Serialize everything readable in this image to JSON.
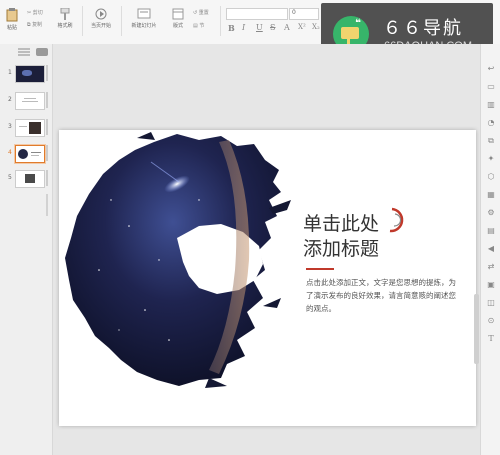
{
  "ribbon": {
    "paste_label": "粘贴",
    "cut_label": "剪切",
    "copy_label": "复制",
    "format_painter_label": "格式刷",
    "from_current_label": "当页开始",
    "new_slide_label": "新建幻灯片",
    "layout_label": "版式",
    "section_label": "节",
    "reset_label": "重置",
    "font_size_value": "0",
    "format_buttons": [
      "B",
      "I",
      "U",
      "S",
      "A",
      "X²",
      "X₂"
    ]
  },
  "watermark": {
    "title": "６６导航",
    "subtitle": "66DAOHAN.COM",
    "logo_color": "#37b56a"
  },
  "slides_panel": {
    "slides": [
      {
        "number": "1",
        "kind": "dark"
      },
      {
        "number": "2",
        "kind": "text"
      },
      {
        "number": "3",
        "kind": "mixed"
      },
      {
        "number": "4",
        "kind": "current"
      },
      {
        "number": "5",
        "kind": "photo"
      }
    ],
    "selected": "4"
  },
  "slide": {
    "title_line1": "单击此处",
    "title_line2": "添加标题",
    "body": "点击此处添加正文，文字是您思想的提炼，为了演示发布的良好效果，请言简意赅的阐述您的观点。",
    "accent_color": "#c0392b"
  },
  "right_toolbar": {
    "text_tool": "T"
  }
}
